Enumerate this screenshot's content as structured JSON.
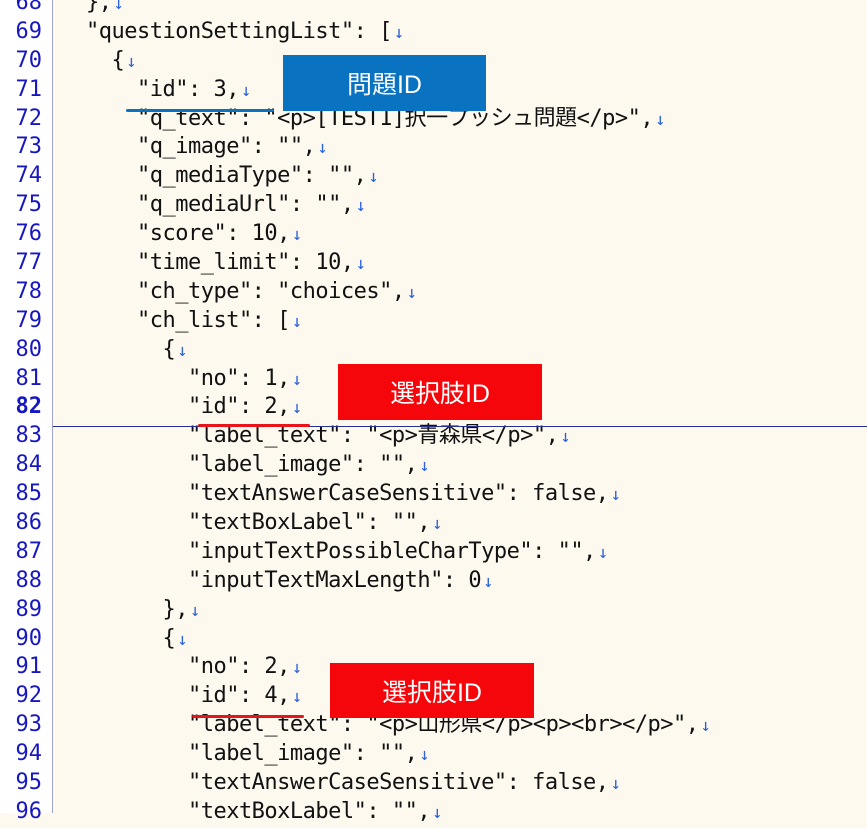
{
  "editor": {
    "eol_marker": "↓",
    "current_line": "82",
    "lines": [
      {
        "num": "68",
        "text": "},"
      },
      {
        "num": "69",
        "text": "\"questionSettingList\": ["
      },
      {
        "num": "70",
        "text": "  {"
      },
      {
        "num": "71",
        "text": "    \"id\": 3,"
      },
      {
        "num": "72",
        "text": "    \"q_text\": \"<p>[TEST1]択一プッシュ問題</p>\","
      },
      {
        "num": "73",
        "text": "    \"q_image\": \"\","
      },
      {
        "num": "74",
        "text": "    \"q_mediaType\": \"\","
      },
      {
        "num": "75",
        "text": "    \"q_mediaUrl\": \"\","
      },
      {
        "num": "76",
        "text": "    \"score\": 10,"
      },
      {
        "num": "77",
        "text": "    \"time_limit\": 10,"
      },
      {
        "num": "78",
        "text": "    \"ch_type\": \"choices\","
      },
      {
        "num": "79",
        "text": "    \"ch_list\": ["
      },
      {
        "num": "80",
        "text": "      {"
      },
      {
        "num": "81",
        "text": "        \"no\": 1,"
      },
      {
        "num": "82",
        "text": "        \"id\": 2,"
      },
      {
        "num": "83",
        "text": "        \"label_text\": \"<p>青森県</p>\","
      },
      {
        "num": "84",
        "text": "        \"label_image\": \"\","
      },
      {
        "num": "85",
        "text": "        \"textAnswerCaseSensitive\": false,"
      },
      {
        "num": "86",
        "text": "        \"textBoxLabel\": \"\","
      },
      {
        "num": "87",
        "text": "        \"inputTextPossibleCharType\": \"\","
      },
      {
        "num": "88",
        "text": "        \"inputTextMaxLength\": 0"
      },
      {
        "num": "89",
        "text": "      },"
      },
      {
        "num": "90",
        "text": "      {"
      },
      {
        "num": "91",
        "text": "        \"no\": 2,"
      },
      {
        "num": "92",
        "text": "        \"id\": 4,"
      },
      {
        "num": "93",
        "text": "        \"label_text\": \"<p>山形県</p><p><br></p>\","
      },
      {
        "num": "94",
        "text": "        \"label_image\": \"\","
      },
      {
        "num": "95",
        "text": "        \"textAnswerCaseSensitive\": false,"
      },
      {
        "num": "96",
        "text": "        \"textBoxLabel\": \"\","
      }
    ]
  },
  "annotations": {
    "question_id_label": "問題ID",
    "choice_id_label_1": "選択肢ID",
    "choice_id_label_2": "選択肢ID"
  },
  "colors": {
    "background": "#fdf9ef",
    "line_number": "#1717c2",
    "eol_arrow": "#2c62d8",
    "question_callout": "#0a73c1",
    "choice_callout": "#f4060a"
  }
}
